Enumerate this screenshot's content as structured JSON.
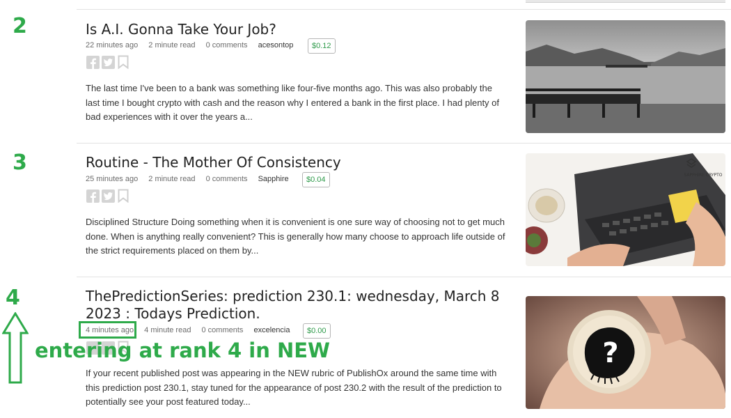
{
  "posts": [
    {
      "rank": "2",
      "title": "Is A.I. Gonna Take Your Job?",
      "time": "22 minutes ago",
      "read": "2 minute read",
      "comments": "0 comments",
      "author": "acesontop",
      "price": "$0.12",
      "excerpt": "The last time I've been to a bank was something like four-five months ago. This was also probably the last time I bought crypto with cash and the reason why I entered a bank in the first place. I had plenty of bad experiences with it over the years a..."
    },
    {
      "rank": "3",
      "title": "Routine - The Mother Of Consistency",
      "time": "25 minutes ago",
      "read": "2 minute read",
      "comments": "0 comments",
      "author": "Sapphire",
      "price": "$0.04",
      "excerpt": "Disciplined Structure Doing something when it is convenient is one sure way of choosing not to get much done. When is anything really convenient? This is generally how many choose to approach life outside of the strict requirements placed on them by...",
      "thumb_brand": "SAPPHIRE CRYPTO"
    },
    {
      "rank": "4",
      "title": "ThePredictionSeries: prediction 230.1: wednesday, March 8 2023 : Todays Prediction.",
      "time": "4 minutes ago",
      "read": "4 minute read",
      "comments": "0 comments",
      "author": "excelencia",
      "price": "$0.00",
      "excerpt": "If your recent published post was appearing in the NEW rubric of PublishOx around the same time with this prediction post 230.1, stay tuned for the appearance of post 230.2 with the result of the prediction to potentially see your post featured today..."
    }
  ],
  "annotation": {
    "text": "entering at rank 4 in NEW",
    "color": "#2eaa4a"
  },
  "icons": [
    "facebook-icon",
    "twitter-icon",
    "bookmark-icon"
  ],
  "colors": {
    "accent": "#2eaa4a",
    "price": "#2e9a4a"
  }
}
